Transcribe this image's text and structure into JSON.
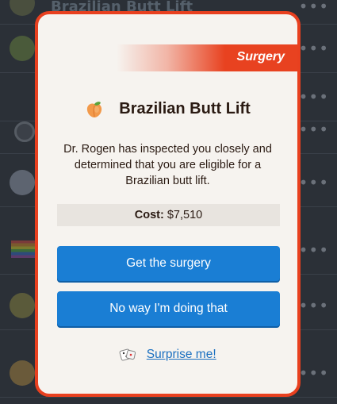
{
  "background": {
    "top_title": "Brazilian Butt Lift"
  },
  "modal": {
    "category": "Surgery",
    "icon": "peach-icon",
    "title": "Brazilian Butt Lift",
    "description": "Dr. Rogen has inspected you closely and determined that you are eligible for a Brazilian butt lift.",
    "cost_label": "Cost:",
    "cost_value": "$7,510",
    "primary_button": "Get the surgery",
    "secondary_button": "No way I'm doing that",
    "surprise_icon": "dice-icon",
    "surprise_link": "Surprise me!"
  },
  "colors": {
    "accent": "#e8401f",
    "button": "#1a7ed4",
    "link": "#1a6fc0"
  }
}
